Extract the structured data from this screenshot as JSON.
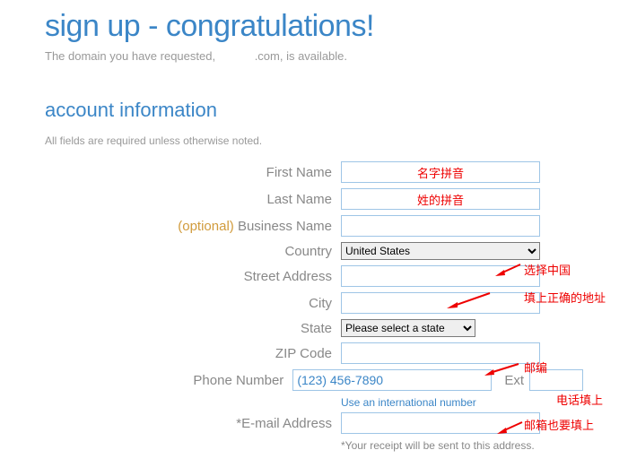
{
  "header": {
    "title": "sign up - congratulations!",
    "avail_prefix": "The domain you have requested, ",
    "avail_suffix": ".com, is available."
  },
  "section": {
    "title": "account information",
    "required_note": "All fields are required unless otherwise noted."
  },
  "labels": {
    "first_name": "First Name",
    "last_name": "Last Name",
    "business_name": "Business Name",
    "optional": "(optional) ",
    "country": "Country",
    "street": "Street Address",
    "city": "City",
    "state": "State",
    "zip": "ZIP Code",
    "phone": "Phone Number",
    "ext": "Ext",
    "email": "*E-mail Address"
  },
  "values": {
    "first_name": "名字拼音",
    "last_name": "姓的拼音",
    "business_name": "",
    "country_selected": "United States",
    "state_selected": "Please select a state",
    "street": "",
    "city": "",
    "zip": "",
    "phone": "(123) 456-7890",
    "ext": "",
    "email": ""
  },
  "notes": {
    "intl_phone": "Use an international number",
    "email_receipt": "*Your receipt will be sent to this address."
  },
  "annotations": {
    "country": "选择中国",
    "street": "填上正确的地址",
    "zip": "邮编",
    "phone": "电话填上",
    "email": "邮箱也要填上"
  }
}
